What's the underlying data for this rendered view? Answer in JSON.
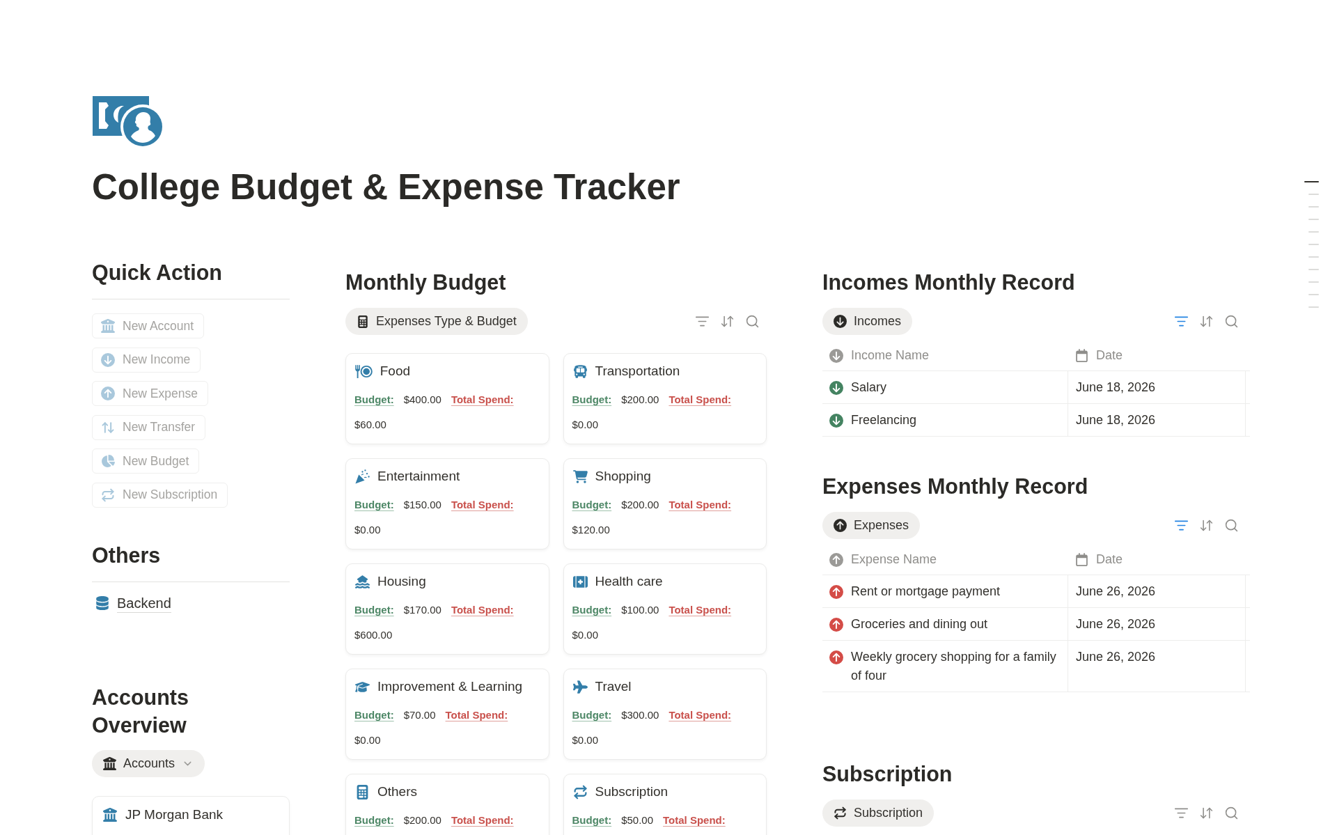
{
  "page": {
    "title": "College Budget & Expense Tracker"
  },
  "outline": [
    {
      "selected": true
    },
    {
      "selected": false
    },
    {
      "selected": false
    },
    {
      "selected": false
    },
    {
      "selected": false
    },
    {
      "selected": false
    },
    {
      "selected": false
    },
    {
      "selected": false
    },
    {
      "selected": false
    },
    {
      "selected": false
    },
    {
      "selected": false
    }
  ],
  "quick_action": {
    "heading": "Quick Action",
    "buttons": [
      {
        "kind": "account",
        "label": "New Account",
        "disabled": true
      },
      {
        "kind": "income",
        "label": "New Income",
        "disabled": true
      },
      {
        "kind": "expense",
        "label": "New Expense",
        "disabled": true
      },
      {
        "kind": "transfer",
        "label": "New Transfer",
        "disabled": true
      },
      {
        "kind": "budget",
        "label": "New Budget",
        "disabled": true
      },
      {
        "kind": "subscription",
        "label": "New Subscription",
        "disabled": true
      }
    ]
  },
  "others": {
    "heading": "Others",
    "links": [
      {
        "label": "Backend"
      }
    ]
  },
  "accounts_overview": {
    "heading": "Accounts Overview",
    "view_tab": {
      "label": "Accounts",
      "selected": true
    },
    "cards": [
      {
        "name": "JP Morgan Bank"
      }
    ]
  },
  "monthly_budget": {
    "heading": "Monthly Budget",
    "view_tab": {
      "label": "Expenses Type & Budget",
      "selected": true
    },
    "filter_active": false,
    "cards": [
      {
        "kind": "food",
        "name": "Food",
        "budget_label": "Budget:",
        "budget": "$400.00",
        "spend_label": "Total Spend:",
        "spend": "$60.00"
      },
      {
        "kind": "transportation",
        "name": "Transportation",
        "budget_label": "Budget:",
        "budget": "$200.00",
        "spend_label": "Total Spend:",
        "spend": "$0.00"
      },
      {
        "kind": "entertainment",
        "name": "Entertainment",
        "budget_label": "Budget:",
        "budget": "$150.00",
        "spend_label": "Total Spend:",
        "spend": "$0.00"
      },
      {
        "kind": "shopping",
        "name": "Shopping",
        "budget_label": "Budget:",
        "budget": "$200.00",
        "spend_label": "Total Spend:",
        "spend": "$120.00"
      },
      {
        "kind": "housing",
        "name": "Housing",
        "budget_label": "Budget:",
        "budget": "$170.00",
        "spend_label": "Total Spend:",
        "spend": "$600.00"
      },
      {
        "kind": "health",
        "name": "Health care",
        "budget_label": "Budget:",
        "budget": "$100.00",
        "spend_label": "Total Spend:",
        "spend": "$0.00"
      },
      {
        "kind": "learning",
        "name": "Improvement & Learning",
        "budget_label": "Budget:",
        "budget": "$70.00",
        "spend_label": "Total Spend:",
        "spend": "$0.00"
      },
      {
        "kind": "travel",
        "name": "Travel",
        "budget_label": "Budget:",
        "budget": "$300.00",
        "spend_label": "Total Spend:",
        "spend": "$0.00"
      },
      {
        "kind": "others",
        "name": "Others",
        "budget_label": "Budget:",
        "budget": "$200.00",
        "spend_label": "Total Spend:"
      },
      {
        "kind": "subscription",
        "name": "Subscription",
        "budget_label": "Budget:",
        "budget": "$50.00",
        "spend_label": "Total Spend:"
      }
    ]
  },
  "records": [
    {
      "kind": "income",
      "heading": "Incomes Monthly Record",
      "view_tab": {
        "label": "Incomes",
        "selected": true
      },
      "filter_active": true,
      "columns": [
        {
          "kind": "name",
          "label": "Income Name"
        },
        {
          "kind": "date",
          "label": "Date"
        }
      ],
      "rows": [
        {
          "name": "Salary",
          "date": "June 18, 2026"
        },
        {
          "name": "Freelancing",
          "date": "June 18, 2026"
        }
      ]
    },
    {
      "kind": "expense",
      "heading": "Expenses Monthly Record",
      "view_tab": {
        "label": "Expenses",
        "selected": true
      },
      "filter_active": true,
      "columns": [
        {
          "kind": "name",
          "label": "Expense Name"
        },
        {
          "kind": "date",
          "label": "Date"
        }
      ],
      "rows": [
        {
          "name": "Rent or mortgage payment",
          "date": "June 26, 2026"
        },
        {
          "name": "Groceries and dining out",
          "date": "June 26, 2026"
        },
        {
          "name": "Weekly grocery shopping for a family of four",
          "date": "June 26, 2026"
        }
      ]
    },
    {
      "kind": "subscription",
      "heading": "Subscription",
      "view_tab": {
        "label": "Subscription",
        "selected": true
      },
      "filter_active": false
    }
  ]
}
